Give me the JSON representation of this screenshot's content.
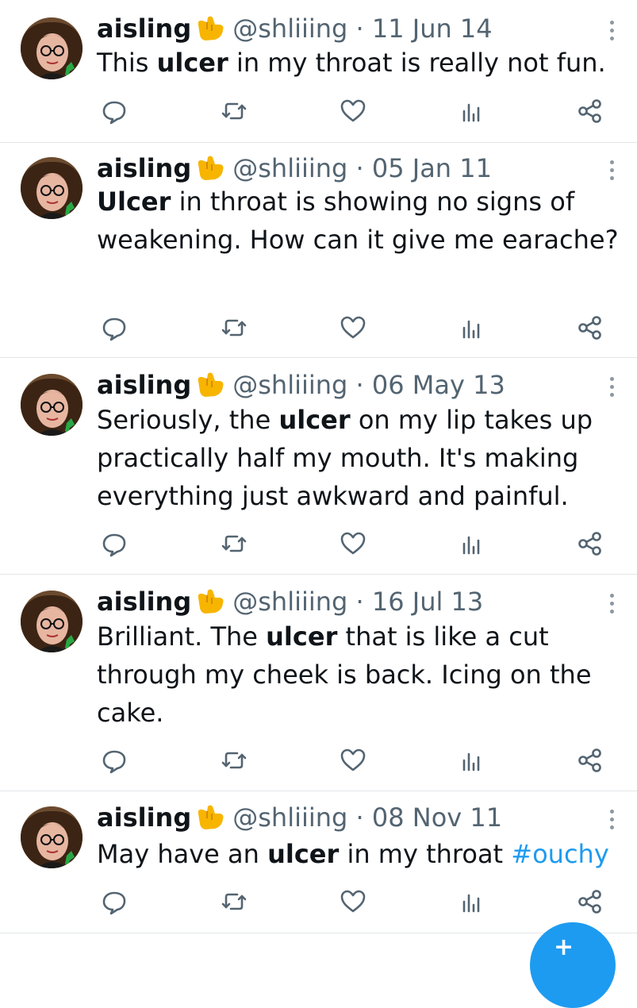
{
  "tweets": [
    {
      "name": "aisling",
      "handle": "@shliiing",
      "sep": " · ",
      "date": "11 Jun 14",
      "segments": [
        {
          "t": "This ",
          "b": false
        },
        {
          "t": "ulcer",
          "b": true
        },
        {
          "t": " in my throat is really not fun.",
          "b": false
        }
      ]
    },
    {
      "name": "aisling",
      "handle": "@shliiing",
      "sep": " · ",
      "date": "05 Jan 11",
      "segments": [
        {
          "t": "Ulcer",
          "b": true
        },
        {
          "t": " in throat is showing no signs of weakening. How can it give me earache?",
          "b": false
        }
      ]
    },
    {
      "name": "aisling",
      "handle": "@shliiing",
      "sep": " · ",
      "date": "06 May 13",
      "segments": [
        {
          "t": "Seriously, the ",
          "b": false
        },
        {
          "t": "ulcer",
          "b": true
        },
        {
          "t": " on my lip takes up practically half my mouth. It's making everything just awkward and painful.",
          "b": false
        }
      ]
    },
    {
      "name": "aisling",
      "handle": "@shliiing",
      "sep": " · ",
      "date": "16 Jul 13",
      "segments": [
        {
          "t": "Brilliant. The ",
          "b": false
        },
        {
          "t": "ulcer",
          "b": true
        },
        {
          "t": " that is like a cut through my cheek is back. Icing on the cake.",
          "b": false
        }
      ]
    },
    {
      "name": "aisling",
      "handle": "@shliiing",
      "sep": " · ",
      "date": "08 Nov 11",
      "segments": [
        {
          "t": "May have an ",
          "b": false
        },
        {
          "t": "ulcer",
          "b": true
        },
        {
          "t": " in my throat ",
          "b": false
        },
        {
          "t": "#ouchy",
          "b": false,
          "hashtag": true
        }
      ]
    }
  ],
  "icons": {
    "name_emoji": "call-me-hand-emoji",
    "more": "more-vertical-icon",
    "reply": "reply-icon",
    "retweet": "retweet-icon",
    "like": "like-icon",
    "views": "views-icon",
    "share": "share-icon",
    "fab": "compose-icon"
  },
  "colors": {
    "text": "#0f1419",
    "meta": "#536471",
    "icon": "#536471",
    "hashtag": "#1d9bf0",
    "divider": "#e3e6e9",
    "fab": "#1d9bf0"
  }
}
